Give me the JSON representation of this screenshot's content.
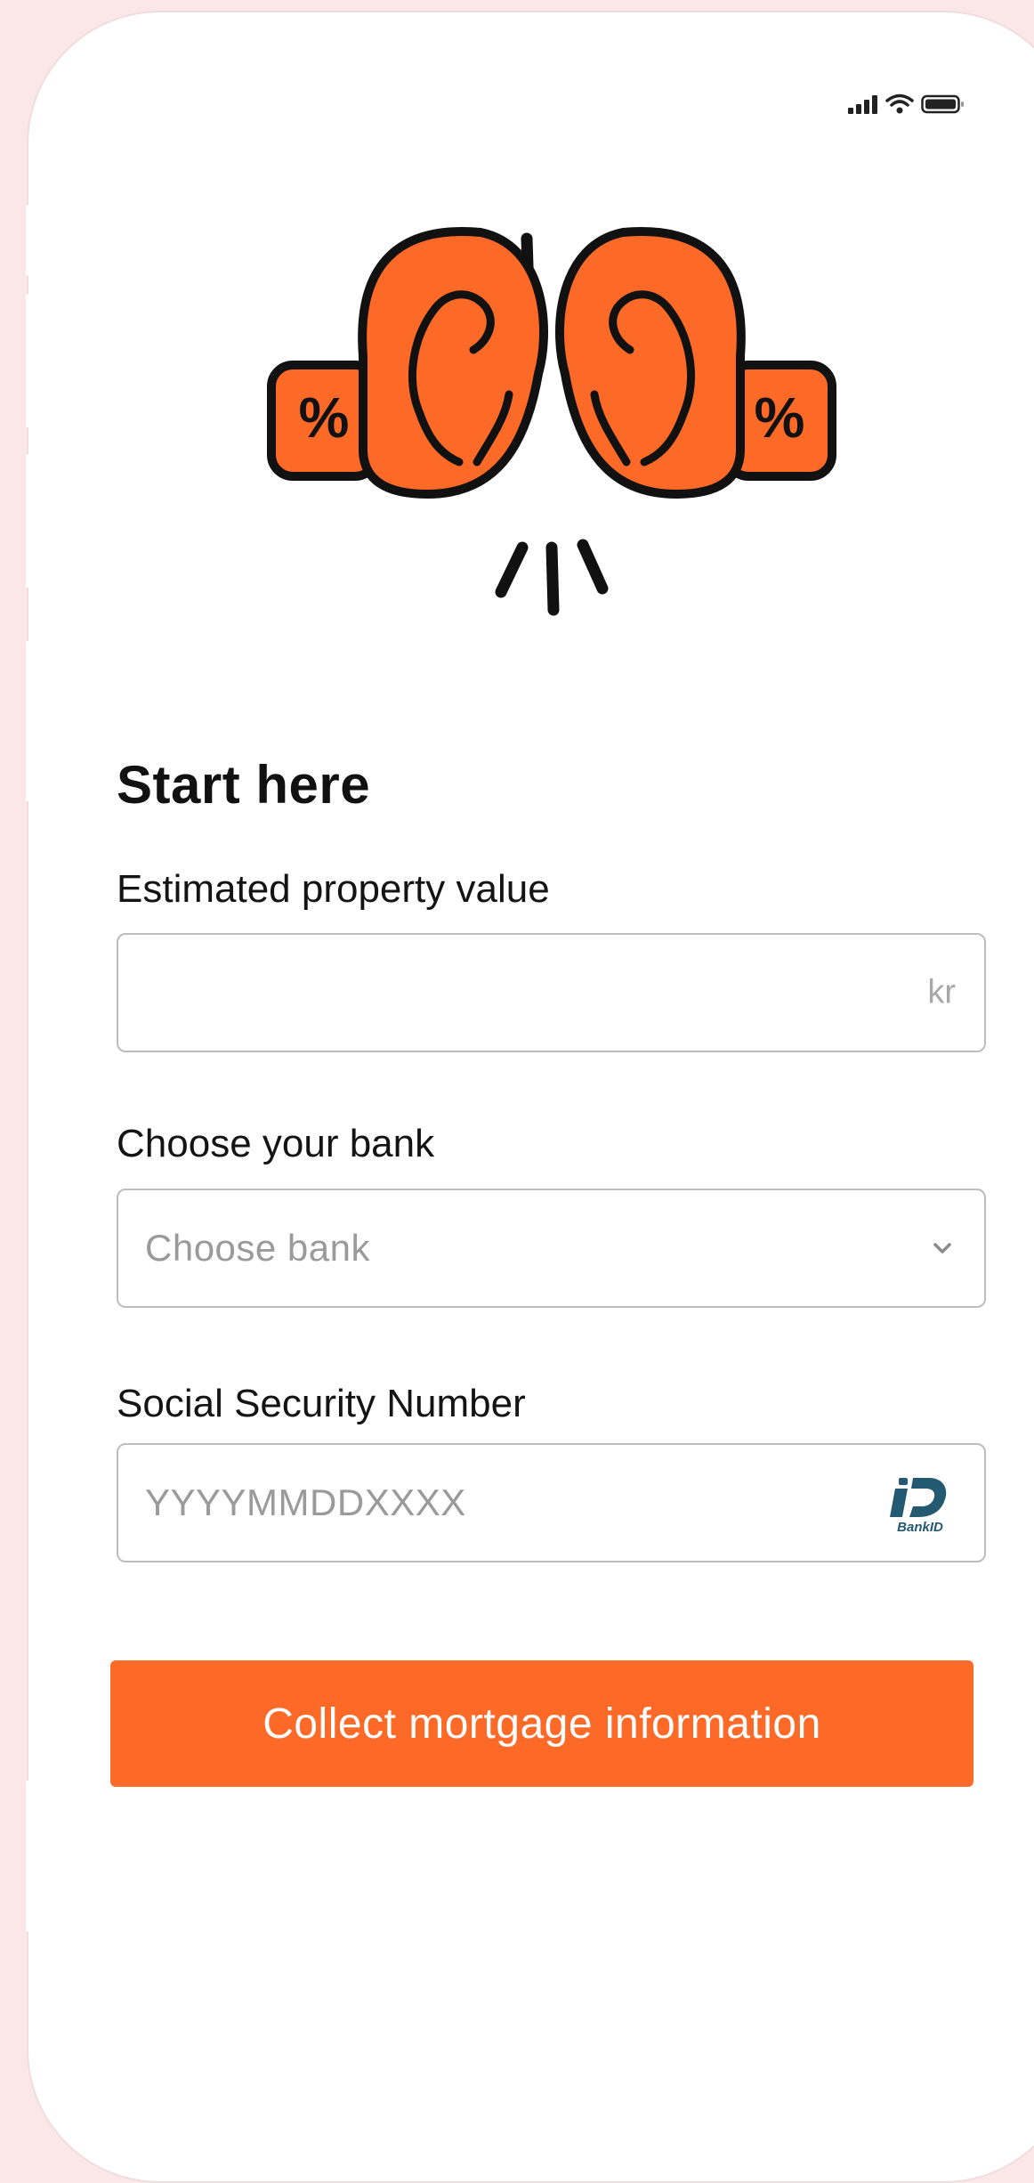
{
  "status_bar": {
    "signal_icon": "signal-bars-icon",
    "wifi_icon": "wifi-icon",
    "battery_icon": "battery-icon"
  },
  "hero": {
    "illustration": "boxing-gloves-icon",
    "glove_mark": "%",
    "accent_color": "#fd6a28"
  },
  "form": {
    "title": "Start here",
    "property_value": {
      "label": "Estimated property value",
      "value": "",
      "suffix": "kr"
    },
    "bank": {
      "label": "Choose your bank",
      "placeholder": "Choose bank",
      "chevron_icon": "chevron-down-icon"
    },
    "ssn": {
      "label": "Social Security Number",
      "placeholder": "YYYYMMDDXXXX",
      "badge_icon": "bankid-icon",
      "badge_text": "BankID"
    }
  },
  "cta": {
    "label": "Collect mortgage information",
    "color": "#fd6a28"
  }
}
